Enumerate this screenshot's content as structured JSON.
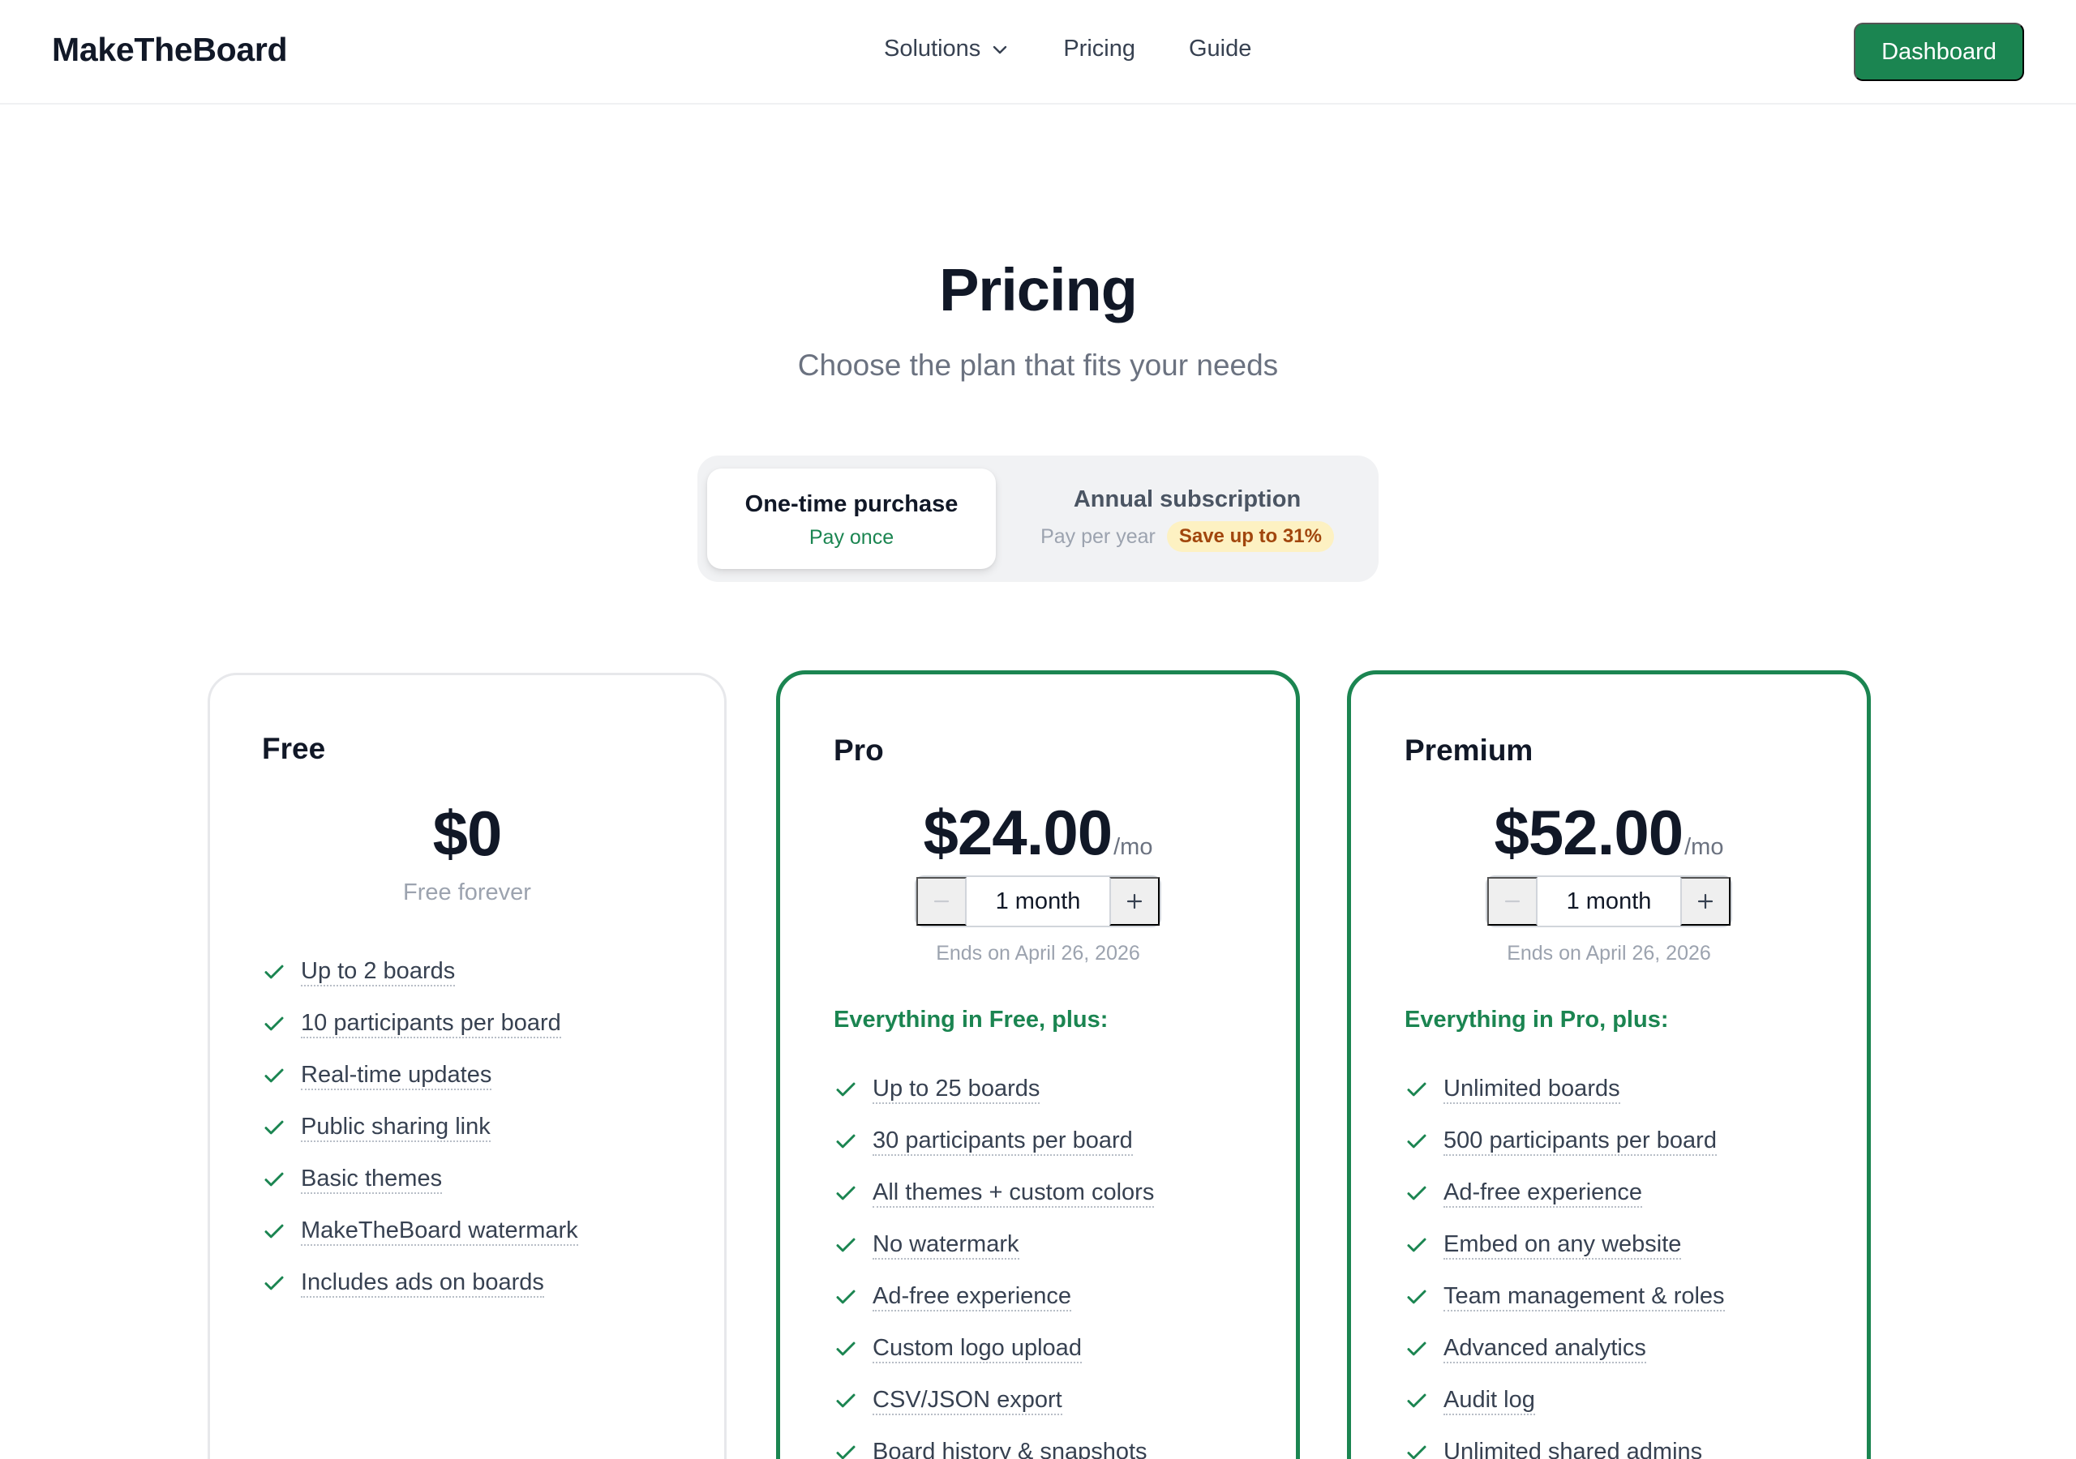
{
  "nav": {
    "logo": "MakeTheBoard",
    "links": [
      {
        "label": "Solutions",
        "has_dropdown": true
      },
      {
        "label": "Pricing"
      },
      {
        "label": "Guide"
      }
    ],
    "cta": "Dashboard"
  },
  "hero": {
    "title": "Pricing",
    "subtitle": "Choose the plan that fits your needs"
  },
  "billing_toggle": {
    "selected": "one_time",
    "one_time": {
      "title": "One-time purchase",
      "subtitle": "Pay once"
    },
    "annual": {
      "title": "Annual subscription",
      "subtitle": "Pay per year",
      "badge": "Save up to 31%"
    }
  },
  "plans": {
    "free": {
      "name": "Free",
      "price": "$0",
      "price_note": "Free forever",
      "features": [
        "Up to 2 boards",
        "10 participants per board",
        "Real-time updates",
        "Public sharing link",
        "Basic themes",
        "MakeTheBoard watermark",
        "Includes ads on boards"
      ]
    },
    "pro": {
      "name": "Pro",
      "price": "$24.00",
      "per": "/mo",
      "duration": "1 month",
      "ends": "Ends on April 26, 2026",
      "features_heading": "Everything in Free, plus:",
      "features": [
        "Up to 25 boards",
        "30 participants per board",
        "All themes + custom colors",
        "No watermark",
        "Ad-free experience",
        "Custom logo upload",
        "CSV/JSON export",
        "Board history & snapshots"
      ]
    },
    "premium": {
      "name": "Premium",
      "price": "$52.00",
      "per": "/mo",
      "duration": "1 month",
      "ends": "Ends on April 26, 2026",
      "features_heading": "Everything in Pro, plus:",
      "features": [
        "Unlimited boards",
        "500 participants per board",
        "Ad-free experience",
        "Embed on any website",
        "Team management & roles",
        "Advanced analytics",
        "Audit log",
        "Unlimited shared admins"
      ]
    }
  },
  "colors": {
    "accent": "#1b8551",
    "badge_bg": "#fdf1c2",
    "badge_text": "#a1460d"
  },
  "stepper_icons": {
    "minus": "minus-icon",
    "plus": "plus-icon"
  },
  "feature_icon": "check-icon"
}
